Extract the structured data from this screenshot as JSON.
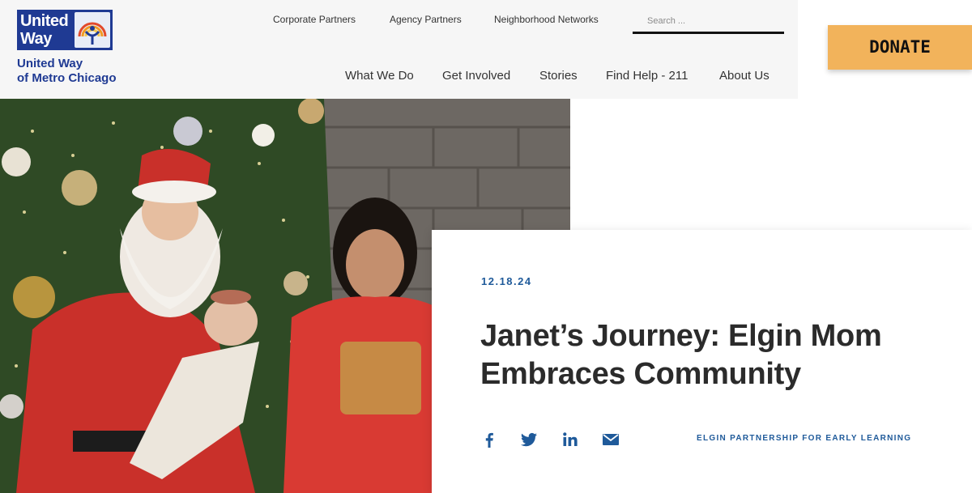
{
  "brand": {
    "logo_line1": "United",
    "logo_line2": "Way",
    "name_line1": "United Way",
    "name_line2": "of Metro Chicago",
    "primary_color": "#1f3a93",
    "accent_color": "#f2b35b"
  },
  "utility_nav": {
    "items": [
      {
        "label": "Corporate Partners"
      },
      {
        "label": "Agency Partners"
      },
      {
        "label": "Neighborhood Networks"
      }
    ]
  },
  "search": {
    "placeholder": "Search ..."
  },
  "main_nav": {
    "items": [
      {
        "label": "What We Do"
      },
      {
        "label": "Get Involved"
      },
      {
        "label": "Stories"
      },
      {
        "label": "Find Help - 211"
      },
      {
        "label": "About Us"
      }
    ]
  },
  "donate": {
    "label": "DONATE"
  },
  "hero": {
    "image_alt": "Santa holding a baby next to a smiling mom in front of a Christmas tree"
  },
  "article": {
    "date": "12.18.24",
    "title": "Janet’s Journey: Elgin Mom Embraces Community",
    "tag": "ELGIN PARTNERSHIP FOR EARLY LEARNING",
    "share_icons": [
      "facebook-icon",
      "twitter-icon",
      "linkedin-icon",
      "email-icon"
    ]
  }
}
